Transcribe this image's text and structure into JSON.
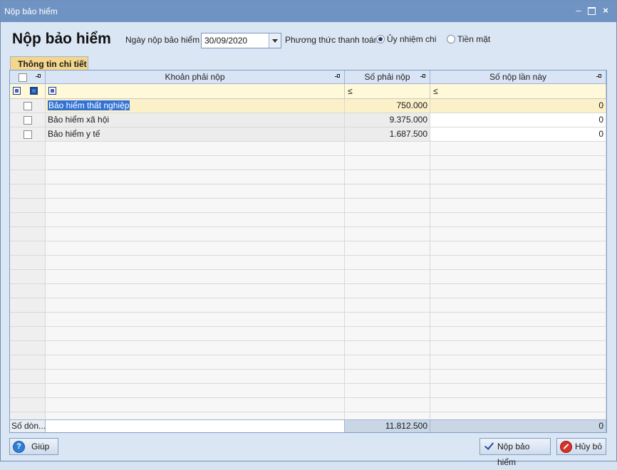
{
  "window": {
    "title": "Nộp bảo hiểm",
    "minimize": "–",
    "close": "×"
  },
  "header": {
    "title": "Nộp bảo hiểm",
    "date_label": "Ngày nộp bảo hiểm",
    "date_value": "30/09/2020",
    "payment_label": "Phương thức thanh toán",
    "payment_options": [
      {
        "label": "Ủy nhiệm chi",
        "selected": true
      },
      {
        "label": "Tiền mặt",
        "selected": false
      }
    ]
  },
  "tabs": [
    {
      "label": "Thông tin chi tiết",
      "active": true
    }
  ],
  "grid": {
    "columns": [
      "Khoản phải nộp",
      "Số phải nộp",
      "Số nộp lần này"
    ],
    "filter_operator": "≤",
    "rows": [
      {
        "name": "Bảo hiểm thất nghiệp",
        "due": "750.000",
        "paid": "0",
        "selected": true
      },
      {
        "name": "Bảo hiểm xã hội",
        "due": "9.375.000",
        "paid": "0",
        "selected": false
      },
      {
        "name": "Bảo hiểm y tế",
        "due": "1.687.500",
        "paid": "0",
        "selected": false
      }
    ],
    "footer": {
      "label": "Số dòn...",
      "total_due": "11.812.500",
      "total_paid": "0"
    }
  },
  "buttons": {
    "help": "Giúp",
    "submit": "Nộp bảo hiểm",
    "cancel": "Hủy bỏ"
  },
  "colors": {
    "titlebar": "#6f94c3",
    "tab_active": "#f5d78c",
    "selection": "#3272d5"
  }
}
